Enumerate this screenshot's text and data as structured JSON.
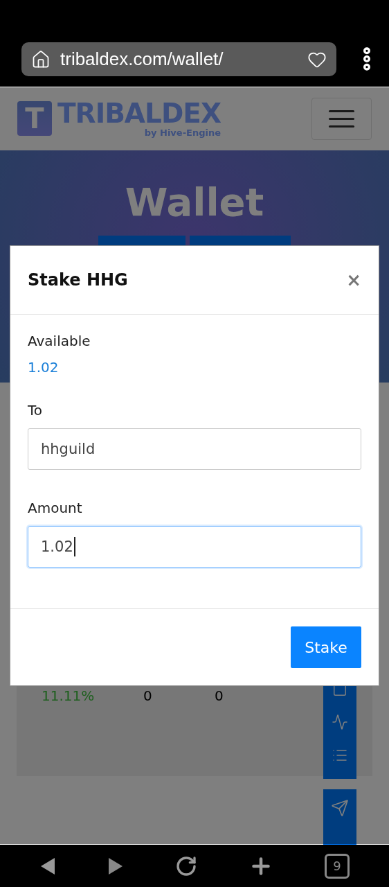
{
  "browser": {
    "url": "tribaldex.com/wallet/",
    "tab_count": "9"
  },
  "site": {
    "logo_letter": "T",
    "logo_name": "TRIBALDEX",
    "logo_tagline": "by Hive-Engine",
    "hero_title": "Wallet"
  },
  "token_row": {
    "cells": [
      {
        "text": "11.11%",
        "kind": "positive"
      },
      {
        "text": "0",
        "kind": "plain"
      },
      {
        "text": "0",
        "kind": "plain"
      }
    ]
  },
  "modal": {
    "title": "Stake HHG",
    "close": "×",
    "available_label": "Available",
    "available_value": "1.02",
    "fields": [
      {
        "label": "To",
        "value": "hhguild",
        "focused": false
      },
      {
        "label": "Amount",
        "value": "1.02",
        "focused": true
      }
    ],
    "submit": "Stake"
  }
}
